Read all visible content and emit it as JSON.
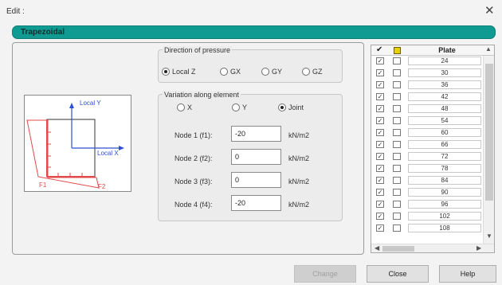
{
  "window": {
    "title": "Edit :",
    "close_glyph": "✕"
  },
  "section_title": "Trapezoidal",
  "diagram": {
    "local_y_label": "Local Y",
    "local_x_label": "Local X",
    "f1_label": "F1",
    "f2_label": "F2",
    "accent_color": "#e04a4a",
    "axis_color": "#2d4fd7"
  },
  "direction": {
    "label": "Direction of pressure",
    "options": [
      "Local Z",
      "GX",
      "GY",
      "GZ"
    ],
    "selected": "Local Z"
  },
  "variation": {
    "label": "Variation along element",
    "options": [
      "X",
      "Y",
      "Joint"
    ],
    "selected": "Joint"
  },
  "nodes": [
    {
      "label": "Node 1 (f1):",
      "value": "-20",
      "unit": "kN/m2"
    },
    {
      "label": "Node 2 (f2):",
      "value": "0",
      "unit": "kN/m2"
    },
    {
      "label": "Node 3 (f3):",
      "value": "0",
      "unit": "kN/m2"
    },
    {
      "label": "Node 4 (f4):",
      "value": "-20",
      "unit": "kN/m2"
    }
  ],
  "table": {
    "check_header_icon": "check-icon",
    "color_header_icon": "yellow-square-icon",
    "plate_header": "Plate",
    "rows": [
      "24",
      "30",
      "36",
      "42",
      "48",
      "54",
      "60",
      "66",
      "72",
      "78",
      "84",
      "90",
      "96",
      "102",
      "108"
    ]
  },
  "buttons": {
    "change": "Change",
    "close": "Close",
    "help": "Help"
  }
}
